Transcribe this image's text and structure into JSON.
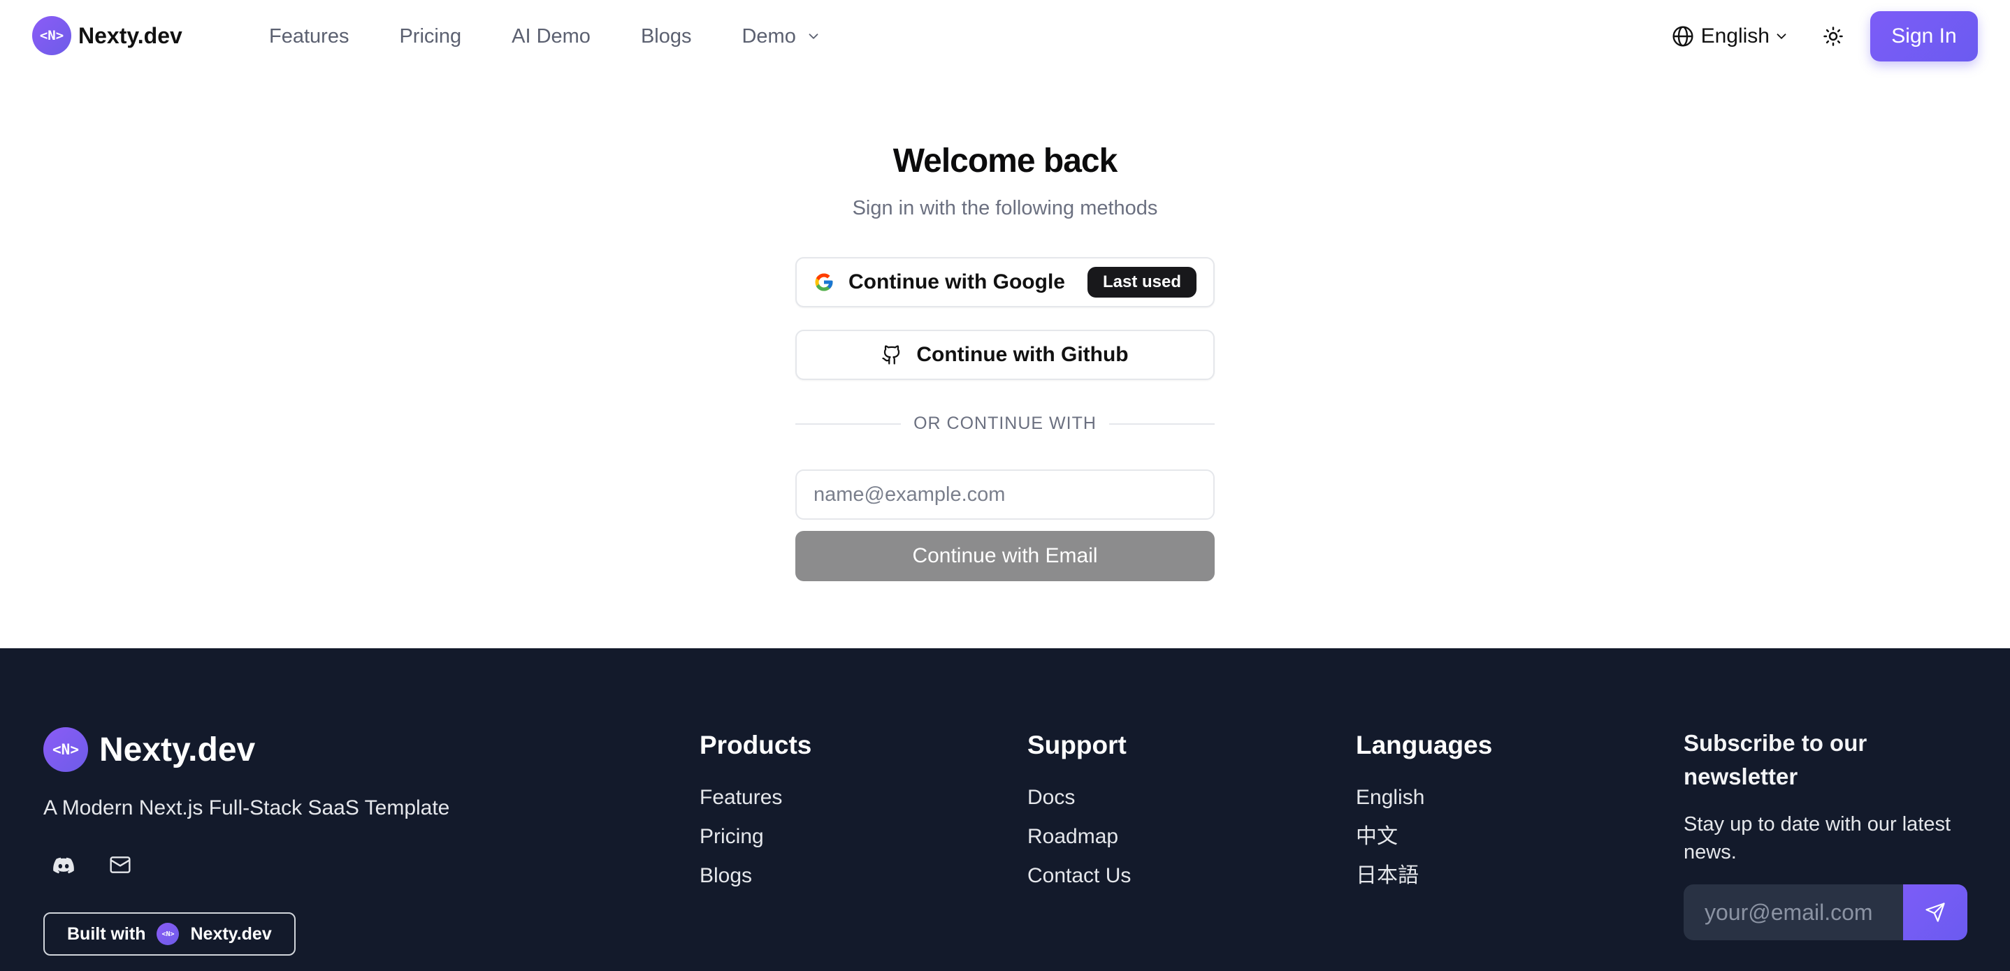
{
  "header": {
    "logo_text": "<N>",
    "brand": "Nexty.dev",
    "nav": [
      {
        "label": "Features"
      },
      {
        "label": "Pricing"
      },
      {
        "label": "AI Demo"
      },
      {
        "label": "Blogs"
      },
      {
        "label": "Demo"
      }
    ],
    "language": "English",
    "sign_in": "Sign In"
  },
  "main": {
    "title": "Welcome back",
    "subtitle": "Sign in with the following methods",
    "google_label": "Continue with Google",
    "google_badge": "Last used",
    "github_label": "Continue with Github",
    "divider": "OR CONTINUE WITH",
    "email_placeholder": "name@example.com",
    "email_button": "Continue with Email"
  },
  "footer": {
    "logo_text": "<N>",
    "brand": "Nexty.dev",
    "tagline": "A Modern Next.js Full-Stack SaaS Template",
    "built_with": "Built with",
    "built_brand": "Nexty.dev",
    "products": {
      "title": "Products",
      "items": [
        "Features",
        "Pricing",
        "Blogs"
      ]
    },
    "support": {
      "title": "Support",
      "items": [
        "Docs",
        "Roadmap",
        "Contact Us"
      ]
    },
    "languages": {
      "title": "Languages",
      "items": [
        "English",
        "中文",
        "日本語"
      ]
    },
    "newsletter": {
      "title": "Subscribe to our newsletter",
      "description": "Stay up to date with our latest news.",
      "placeholder": "your@email.com"
    }
  },
  "colors": {
    "accent": "#6d5cf0",
    "footer_bg": "#131a2b",
    "email_button_bg": "#8c8c8d"
  },
  "icons": [
    "globe-icon",
    "sun-icon",
    "google-icon",
    "github-icon",
    "discord-icon",
    "mail-icon",
    "send-icon",
    "chevron-down-icon"
  ]
}
